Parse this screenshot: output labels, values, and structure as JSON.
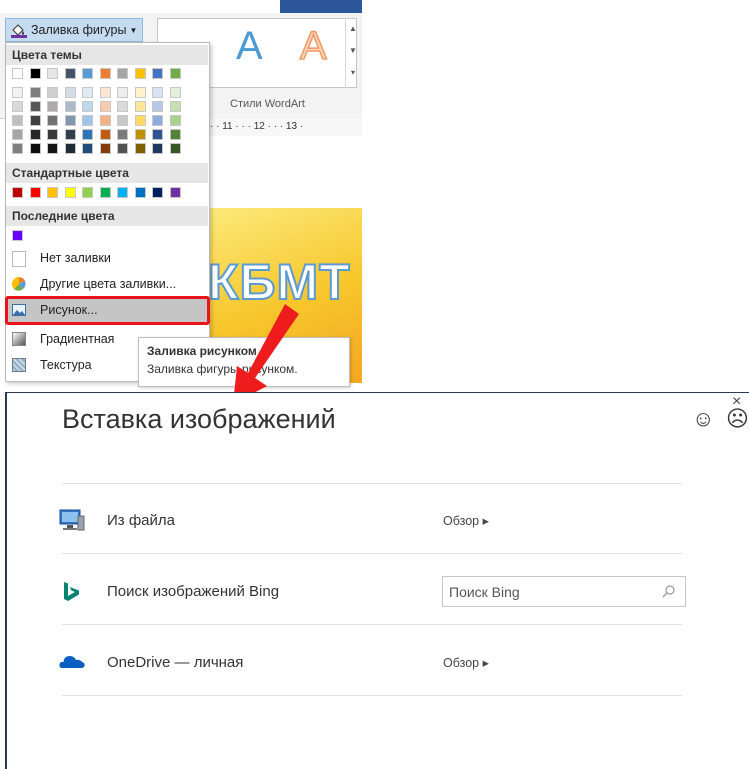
{
  "ribbon": {
    "shape_fill_button": "Заливка фигуры",
    "wordart_letter": "A",
    "wordart_styles_label": "Стили WordArt",
    "ruler_text": "· · 11 · · · 12 · · · 13 ·"
  },
  "document": {
    "banner_text": "КБМТ"
  },
  "fill_menu": {
    "theme_colors_header": "Цвета темы",
    "standard_colors_header": "Стандартные цвета",
    "recent_colors_header": "Последние цвета",
    "items": {
      "no_fill": "Нет заливки",
      "more_colors": "Другие цвета заливки...",
      "picture": "Рисунок...",
      "gradient": "Градиентная",
      "texture": "Текстура"
    },
    "theme_top": [
      "#ffffff",
      "#000000",
      "#e7e6e6",
      "#44546a",
      "#5b9bd5",
      "#ed7d31",
      "#a5a5a5",
      "#ffc000",
      "#4472c4",
      "#70ad47"
    ],
    "theme_shades": [
      [
        "#f2f2f2",
        "#d9d9d9",
        "#bfbfbf",
        "#a6a6a6",
        "#808080"
      ],
      [
        "#7f7f7f",
        "#595959",
        "#404040",
        "#262626",
        "#0d0d0d"
      ],
      [
        "#d0cece",
        "#aeaaaa",
        "#757171",
        "#3a3838",
        "#171616"
      ],
      [
        "#d6dce4",
        "#adb9ca",
        "#8497b0",
        "#333f50",
        "#222a35"
      ],
      [
        "#deebf6",
        "#bdd7ee",
        "#9dc3e6",
        "#2e75b5",
        "#1e4e79"
      ],
      [
        "#fbe5d5",
        "#f7cbac",
        "#f4b183",
        "#c55a11",
        "#833c0b"
      ],
      [
        "#ededed",
        "#dbdbdb",
        "#c9c9c9",
        "#7b7b7b",
        "#525252"
      ],
      [
        "#fff2cc",
        "#fee599",
        "#ffd966",
        "#bf9000",
        "#7f6000"
      ],
      [
        "#dae3f3",
        "#b4c7e7",
        "#8faadc",
        "#2f5496",
        "#1f3864"
      ],
      [
        "#e2efd9",
        "#c5e0b3",
        "#a8d08d",
        "#538135",
        "#375623"
      ]
    ],
    "standard": [
      "#c00000",
      "#ff0000",
      "#ffc000",
      "#ffff00",
      "#92d050",
      "#00b050",
      "#00b0f0",
      "#0070c0",
      "#002060",
      "#7030a0"
    ],
    "recent": [
      "#6600ff"
    ]
  },
  "tooltip": {
    "title": "Заливка рисунком",
    "body": "Заливка фигуры рисунком."
  },
  "dialog": {
    "title": "Вставка изображений",
    "close": "×",
    "smile": "☺",
    "frown": "☹",
    "rows": [
      {
        "label": "Из файла",
        "action": "Обзор ▸"
      },
      {
        "label": "Поиск изображений Bing",
        "placeholder": "Поиск Bing"
      },
      {
        "label": "OneDrive — личная",
        "action": "Обзор ▸"
      }
    ]
  },
  "colors": {
    "highlight_red": "#e8141b",
    "bing_teal": "#008373",
    "onedrive_blue": "#0a5fc2"
  }
}
